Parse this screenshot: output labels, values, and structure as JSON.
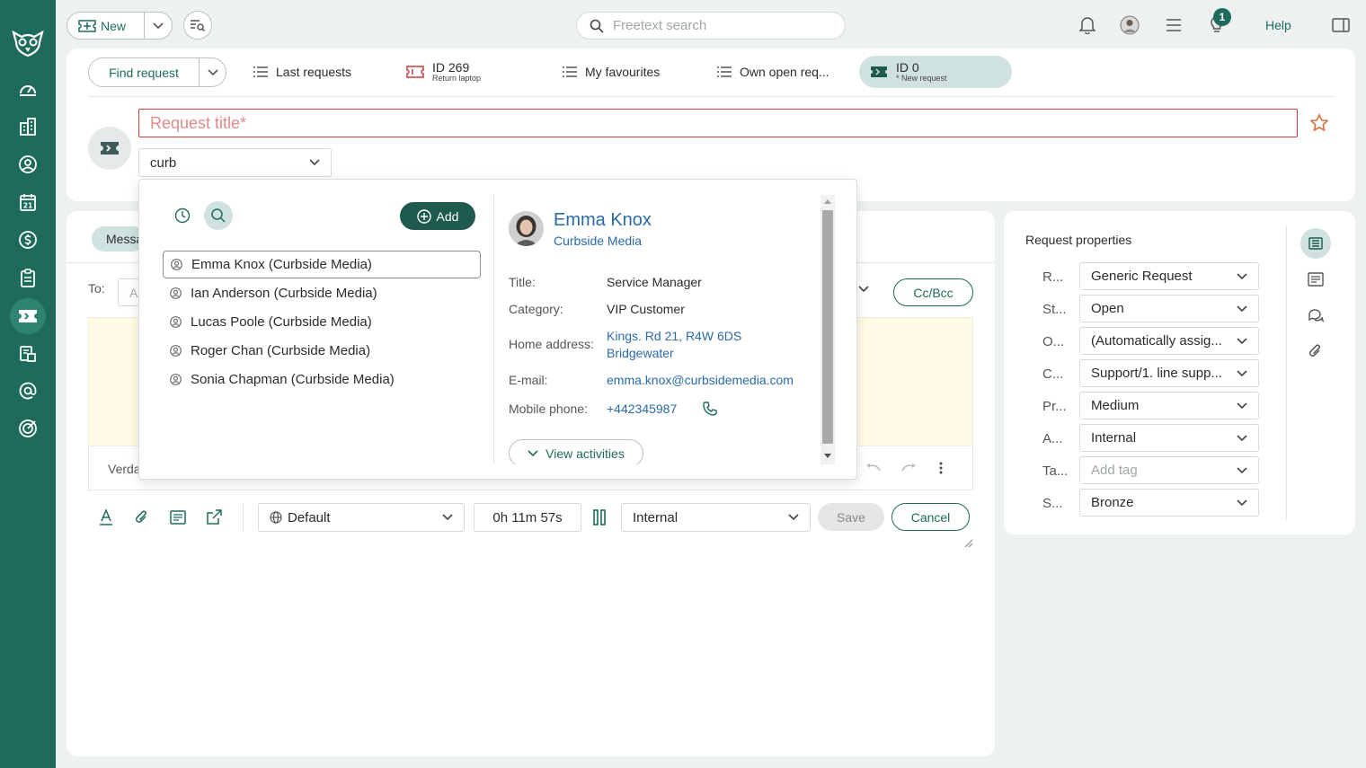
{
  "topbar": {
    "new_label": "New",
    "search_placeholder": "Freetext search",
    "notification_count": "1",
    "help_label": "Help"
  },
  "tabs": {
    "find_request": "Find request",
    "last_requests": "Last requests",
    "id269_main": "ID 269",
    "id269_sub": "Return laptop",
    "my_favourites": "My favourites",
    "own_open": "Own open req...",
    "id0_main": "ID 0",
    "id0_sub": "* New request"
  },
  "form": {
    "title_placeholder": "Request title*",
    "customer_value": "curb",
    "message_tab": "Messa",
    "to_label": "To:",
    "to_placeholder": "A",
    "ccbcc": "Cc/Bcc",
    "font_label": "Verda",
    "language": "Default",
    "timer": "0h 11m 57s",
    "visibility": "Internal",
    "save": "Save",
    "cancel": "Cancel"
  },
  "properties": {
    "title": "Request properties",
    "rows": [
      {
        "label": "R...",
        "value": "Generic Request"
      },
      {
        "label": "St...",
        "value": "Open"
      },
      {
        "label": "O...",
        "value": "(Automatically assig..."
      },
      {
        "label": "C...",
        "value": "Support/1. line supp..."
      },
      {
        "label": "Pr...",
        "value": "Medium"
      },
      {
        "label": "A...",
        "value": "Internal"
      },
      {
        "label": "Ta...",
        "value": "Add tag"
      },
      {
        "label": "S...",
        "value": "Bronze"
      }
    ]
  },
  "popover": {
    "add_label": "Add",
    "results": [
      "Emma Knox (Curbside Media)",
      "Ian Anderson (Curbside Media)",
      "Lucas Poole (Curbside Media)",
      "Roger Chan (Curbside Media)",
      "Sonia Chapman (Curbside Media)"
    ],
    "contact": {
      "name": "Emma Knox",
      "company": "Curbside Media",
      "title_label": "Title:",
      "title_value": "Service Manager",
      "category_label": "Category:",
      "category_value": "VIP Customer",
      "address_label": "Home address:",
      "address_line1": "Kings. Rd 21, R4W 6DS",
      "address_line2": "Bridgewater",
      "email_label": "E-mail:",
      "email_value": "emma.knox@curbsidemedia.com",
      "phone_label": "Mobile phone:",
      "phone_value": "+442345987",
      "view_activities": "View activities"
    }
  },
  "colors": {
    "brand": "#1e6b5c",
    "accent_light": "#cfe2e0",
    "error": "#c63d3d",
    "link": "#2a6aa8"
  }
}
